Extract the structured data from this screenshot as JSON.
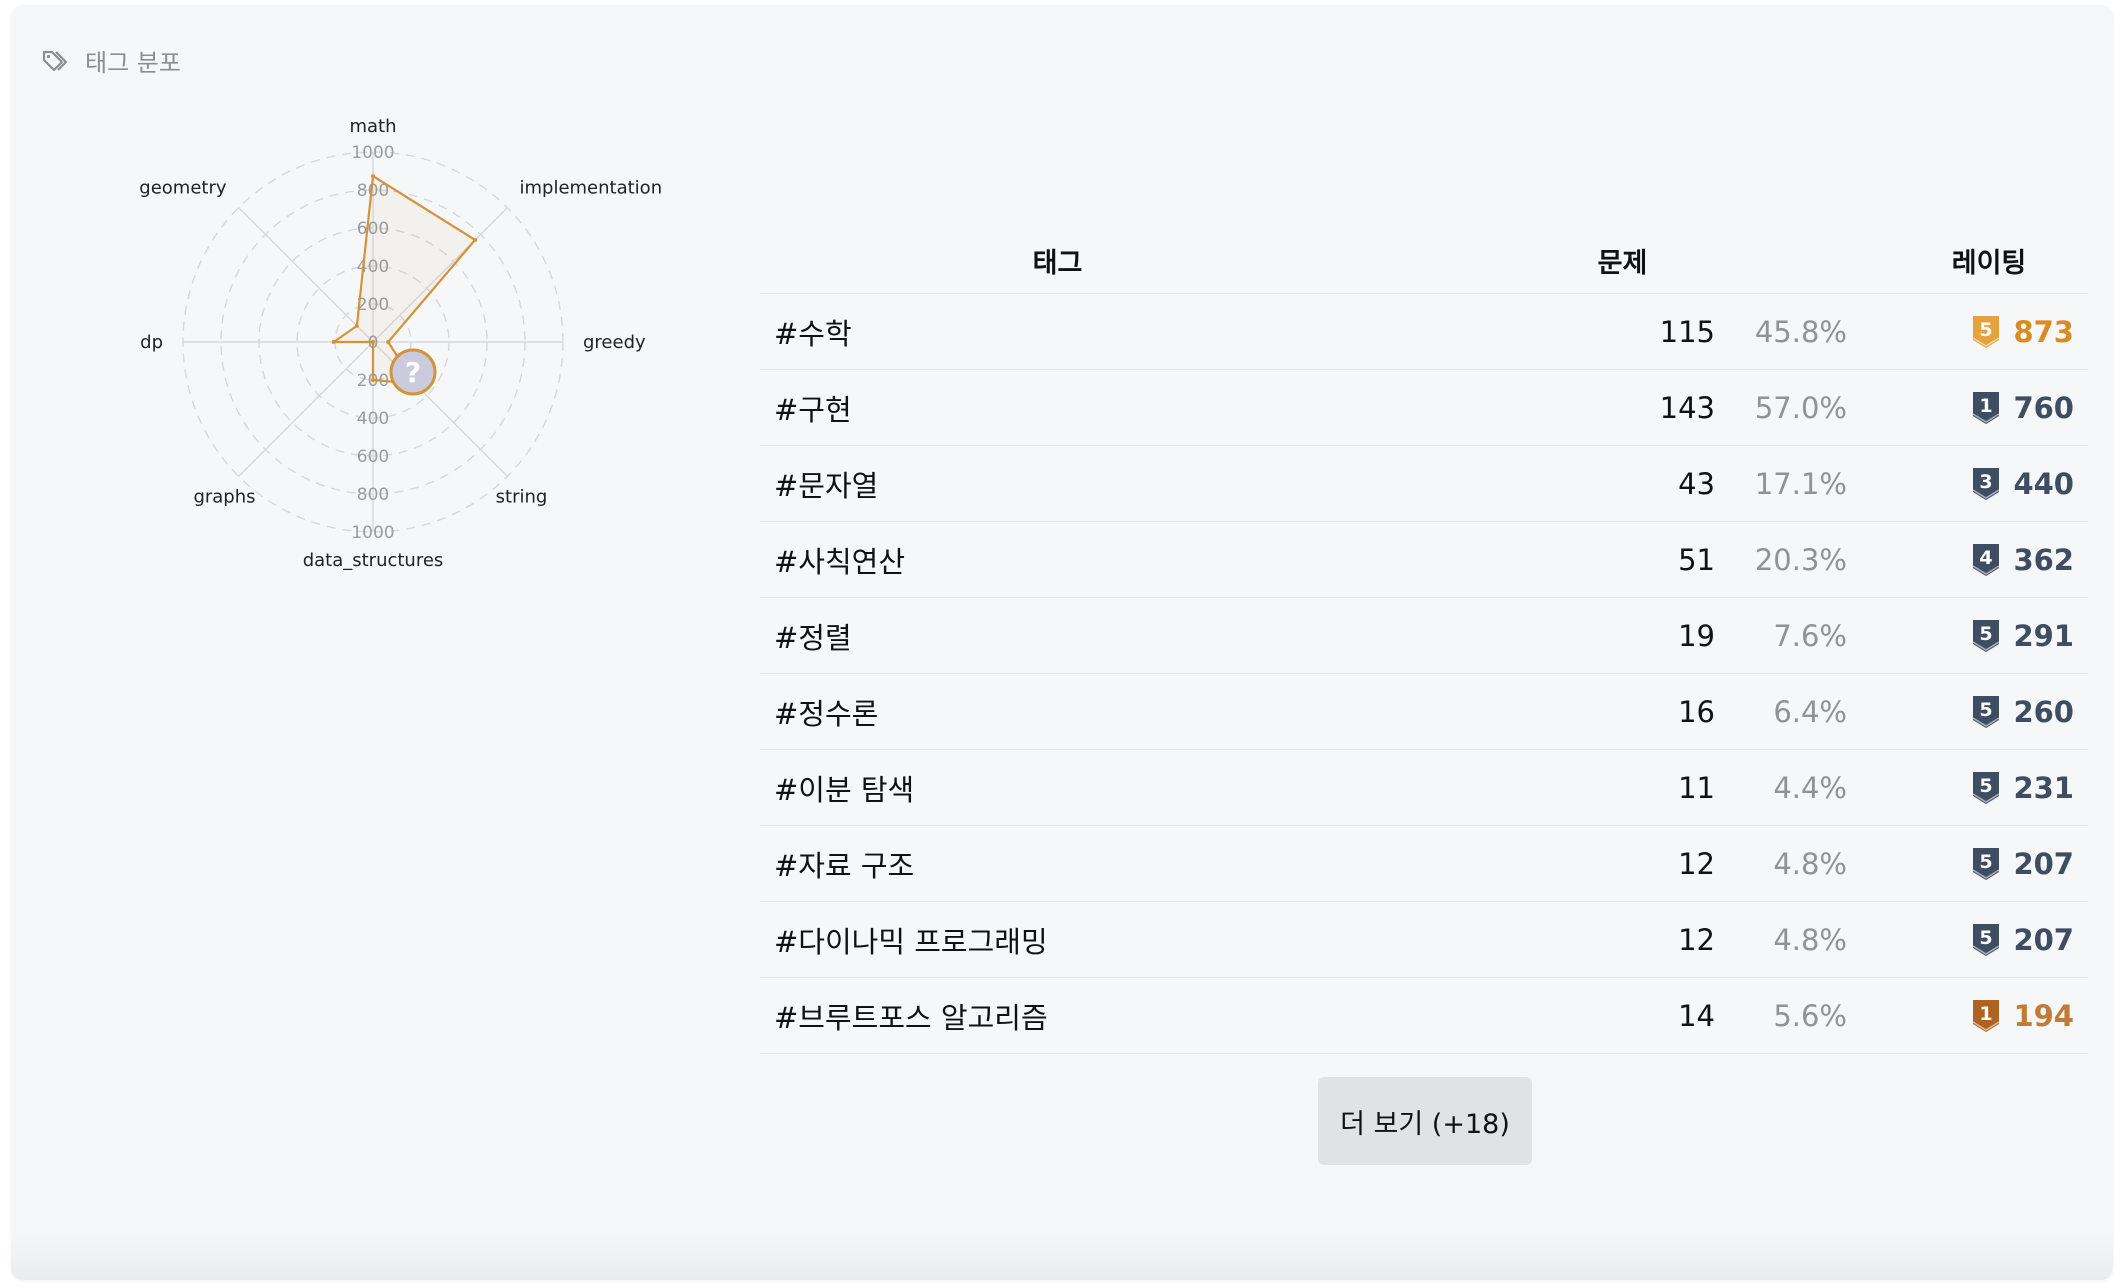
{
  "header": {
    "title": "태그 분포",
    "icon": "tag-icon"
  },
  "chart_data": {
    "type": "radar",
    "axes": [
      "math",
      "implementation",
      "greedy",
      "string",
      "data_structures",
      "graphs",
      "dp",
      "geometry"
    ],
    "values": [
      873,
      760,
      80,
      310,
      200,
      0,
      207,
      120
    ],
    "rmax": 1000,
    "ticks": [
      0,
      200,
      400,
      600,
      800,
      1000
    ],
    "line_color": "#d4933a",
    "grid": true,
    "tooltip_icon": "question-mark-icon"
  },
  "table": {
    "headers": {
      "tag": "태그",
      "problems": "문제",
      "rating": "레이팅"
    },
    "rows": [
      {
        "tag": "#수학",
        "count": "115",
        "pct": "45.8%",
        "tier": "5",
        "tier_color": "#e6a23c",
        "rating": "873",
        "rating_color": "#d98c25"
      },
      {
        "tag": "#구현",
        "count": "143",
        "pct": "57.0%",
        "tier": "1",
        "tier_color": "#3f4d63",
        "rating": "760",
        "rating_color": "#3f4d63"
      },
      {
        "tag": "#문자열",
        "count": "43",
        "pct": "17.1%",
        "tier": "3",
        "tier_color": "#3f4d63",
        "rating": "440",
        "rating_color": "#3f4d63"
      },
      {
        "tag": "#사칙연산",
        "count": "51",
        "pct": "20.3%",
        "tier": "4",
        "tier_color": "#3f4d63",
        "rating": "362",
        "rating_color": "#3f4d63"
      },
      {
        "tag": "#정렬",
        "count": "19",
        "pct": "7.6%",
        "tier": "5",
        "tier_color": "#3f4d63",
        "rating": "291",
        "rating_color": "#3f4d63"
      },
      {
        "tag": "#정수론",
        "count": "16",
        "pct": "6.4%",
        "tier": "5",
        "tier_color": "#3f4d63",
        "rating": "260",
        "rating_color": "#3f4d63"
      },
      {
        "tag": "#이분 탐색",
        "count": "11",
        "pct": "4.4%",
        "tier": "5",
        "tier_color": "#3f4d63",
        "rating": "231",
        "rating_color": "#3f4d63"
      },
      {
        "tag": "#자료 구조",
        "count": "12",
        "pct": "4.8%",
        "tier": "5",
        "tier_color": "#3f4d63",
        "rating": "207",
        "rating_color": "#3f4d63"
      },
      {
        "tag": "#다이나믹 프로그래밍",
        "count": "12",
        "pct": "4.8%",
        "tier": "5",
        "tier_color": "#3f4d63",
        "rating": "207",
        "rating_color": "#3f4d63"
      },
      {
        "tag": "#브루트포스 알고리즘",
        "count": "14",
        "pct": "5.6%",
        "tier": "1",
        "tier_color": "#b0621f",
        "rating": "194",
        "rating_color": "#c27a36"
      }
    ]
  },
  "more_button": {
    "label": "더 보기 (+18)"
  }
}
